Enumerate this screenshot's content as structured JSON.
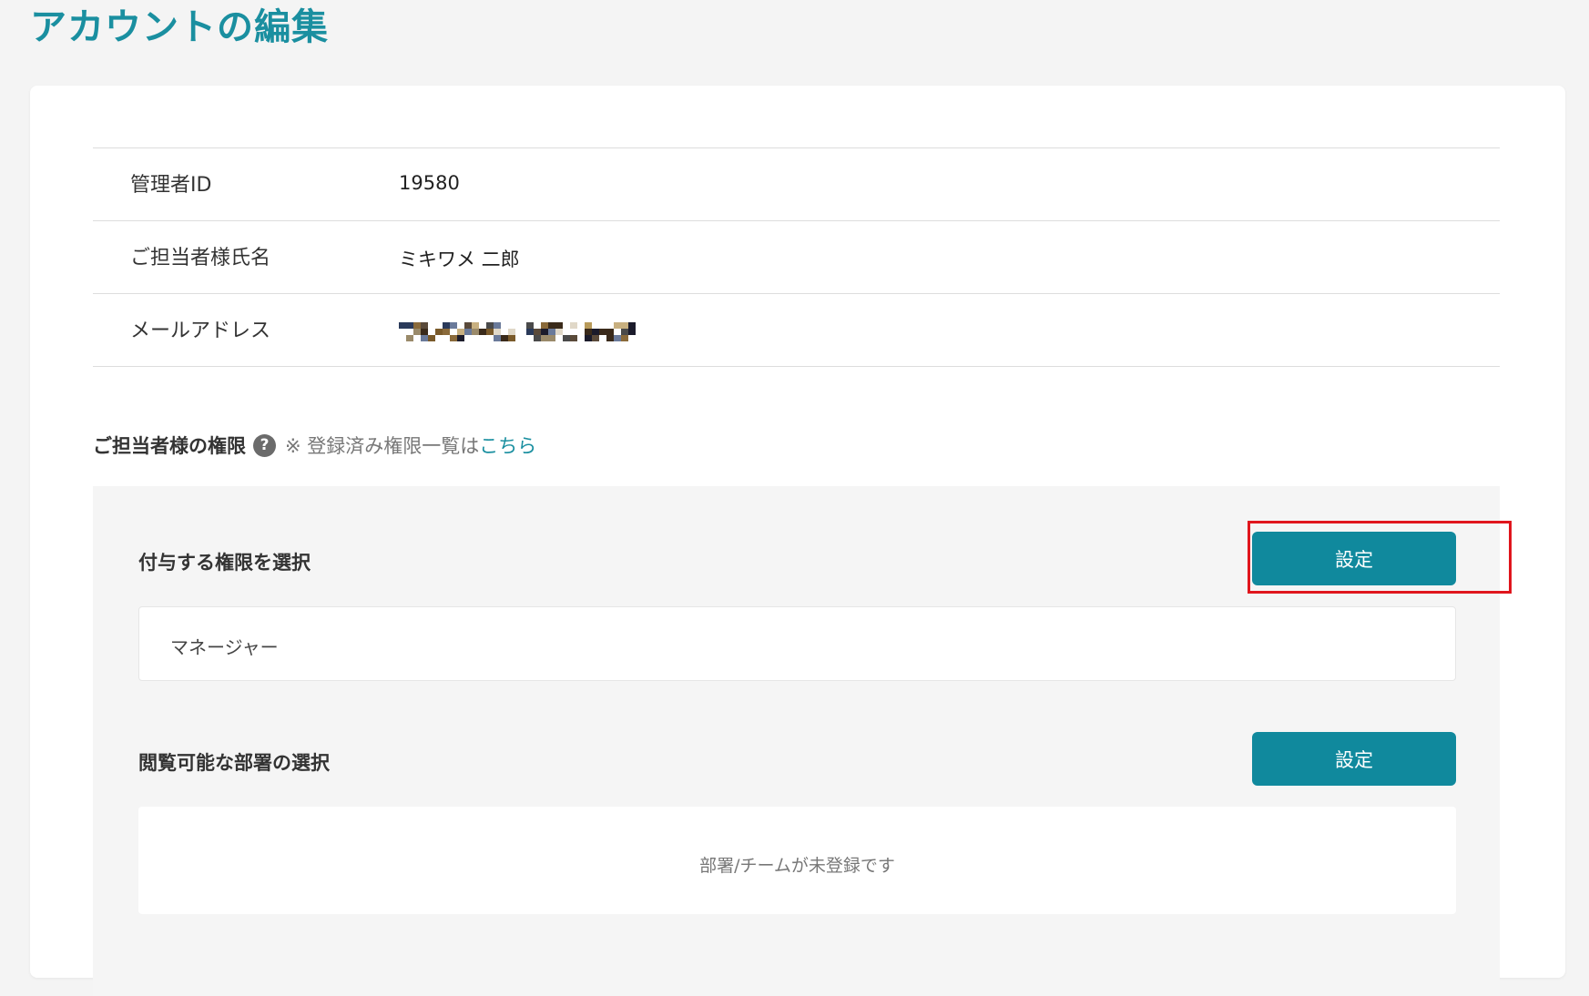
{
  "page": {
    "title": "アカウントの編集"
  },
  "info": {
    "rows": [
      {
        "label": "管理者ID",
        "value": "19580"
      },
      {
        "label": "ご担当者様氏名",
        "value": "ミキワメ 二郎"
      },
      {
        "label": "メールアドレス",
        "value": ""
      }
    ]
  },
  "permissions": {
    "title": "ご担当者様の権限",
    "help_icon": "question-circle-icon",
    "note": "※ 登録済み権限一覧は",
    "link": "こちら",
    "grant": {
      "title": "付与する権限を選択",
      "button": "設定",
      "value": "マネージャー"
    },
    "departments": {
      "title": "閲覧可能な部署の選択",
      "button": "設定",
      "empty": "部署/チームが未登録です"
    }
  },
  "colors": {
    "accent": "#1a8fa0",
    "button": "#10899d",
    "highlight": "#e0161d"
  }
}
